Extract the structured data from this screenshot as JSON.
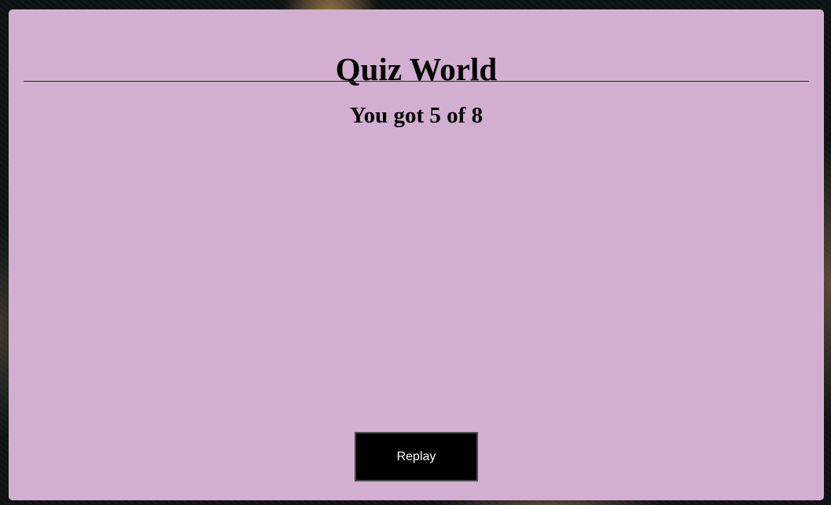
{
  "quiz": {
    "title": "Quiz World",
    "result_text": "You got 5 of 8",
    "replay_label": "Replay"
  },
  "colors": {
    "card_background": "#d2afd1",
    "button_background": "#000000",
    "button_text": "#ffffff"
  }
}
